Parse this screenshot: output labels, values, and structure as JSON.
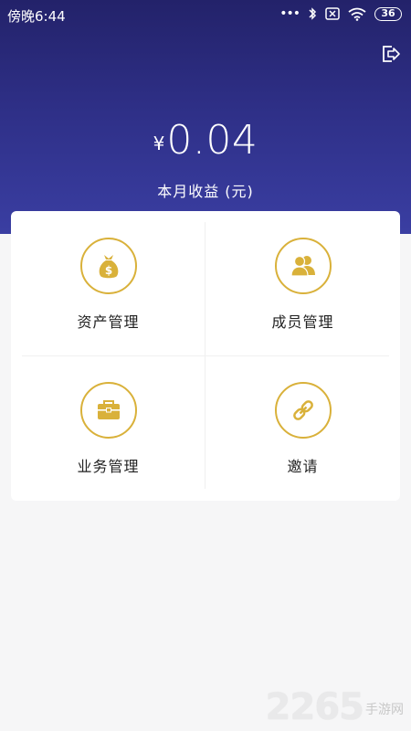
{
  "status_bar": {
    "time": "傍晚6:44",
    "battery": "36"
  },
  "header": {
    "currency_symbol": "¥",
    "amount": "0.04",
    "label": "本月收益 (元)"
  },
  "menu": [
    {
      "label": "资产管理",
      "icon": "money-bag-icon"
    },
    {
      "label": "成员管理",
      "icon": "members-icon"
    },
    {
      "label": "业务管理",
      "icon": "briefcase-icon"
    },
    {
      "label": "邀请",
      "icon": "link-icon"
    }
  ],
  "watermark": {
    "number": "2265",
    "text": "手游网"
  },
  "colors": {
    "header_top": "#23226a",
    "header_bottom": "#3a3ea2",
    "accent_gold": "#d9b13a",
    "background": "#f6f6f7"
  }
}
